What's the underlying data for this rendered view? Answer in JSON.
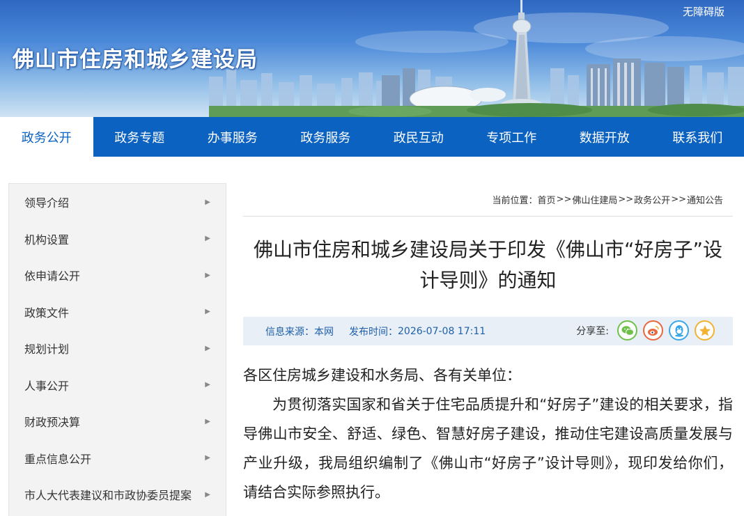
{
  "header": {
    "site_title": "佛山市住房和城乡建设局",
    "accessibility": "无障碍版"
  },
  "nav": {
    "items": [
      {
        "label": "政务公开",
        "active": true
      },
      {
        "label": "政务专题"
      },
      {
        "label": "办事服务"
      },
      {
        "label": "政务服务"
      },
      {
        "label": "政民互动"
      },
      {
        "label": "专项工作"
      },
      {
        "label": "数据开放"
      },
      {
        "label": "联系我们"
      }
    ]
  },
  "sidebar": {
    "items": [
      {
        "label": "领导介绍"
      },
      {
        "label": "机构设置"
      },
      {
        "label": "依申请公开"
      },
      {
        "label": "政策文件"
      },
      {
        "label": "规划计划"
      },
      {
        "label": "人事公开"
      },
      {
        "label": "财政预决算"
      },
      {
        "label": "重点信息公开"
      },
      {
        "label": "市人大代表建议和市政协委员提案"
      }
    ],
    "arrow_icon": "chevron-right-icon"
  },
  "breadcrumb": {
    "prefix": "当前位置：",
    "items": [
      "首页",
      "佛山住建局",
      "政务公开",
      "通知公告"
    ],
    "separator": ">>"
  },
  "article": {
    "title": "佛山市住房和城乡建设局关于印发《佛山市“好房子”设计导则》的通知",
    "source_label": "信息来源：",
    "source": "本网",
    "time_label": "发布时间：",
    "time": "2026-07-08 17:11",
    "share_label": "分享至:",
    "share_icons": [
      "wechat-icon",
      "weibo-icon",
      "qq-icon",
      "qzone-icon"
    ],
    "salutation": "各区住房城乡建设和水务局、各有关单位：",
    "paragraph1": "为贯彻落实国家和省关于住宅品质提升和“好房子”建设的相关要求，指导佛山市安全、舒适、绿色、智慧好房子建设，推动住宅建设高质量发展与产业升级，我局组织编制了《佛山市“好房子”设计导则》，现印发给你们，请结合实际参照执行。"
  },
  "colors": {
    "nav_bg": "#0b62c1",
    "sidebar_bg": "#f3f3f3",
    "info_bar_bg": "#e9eff6",
    "info_text": "#1e5fa8"
  }
}
